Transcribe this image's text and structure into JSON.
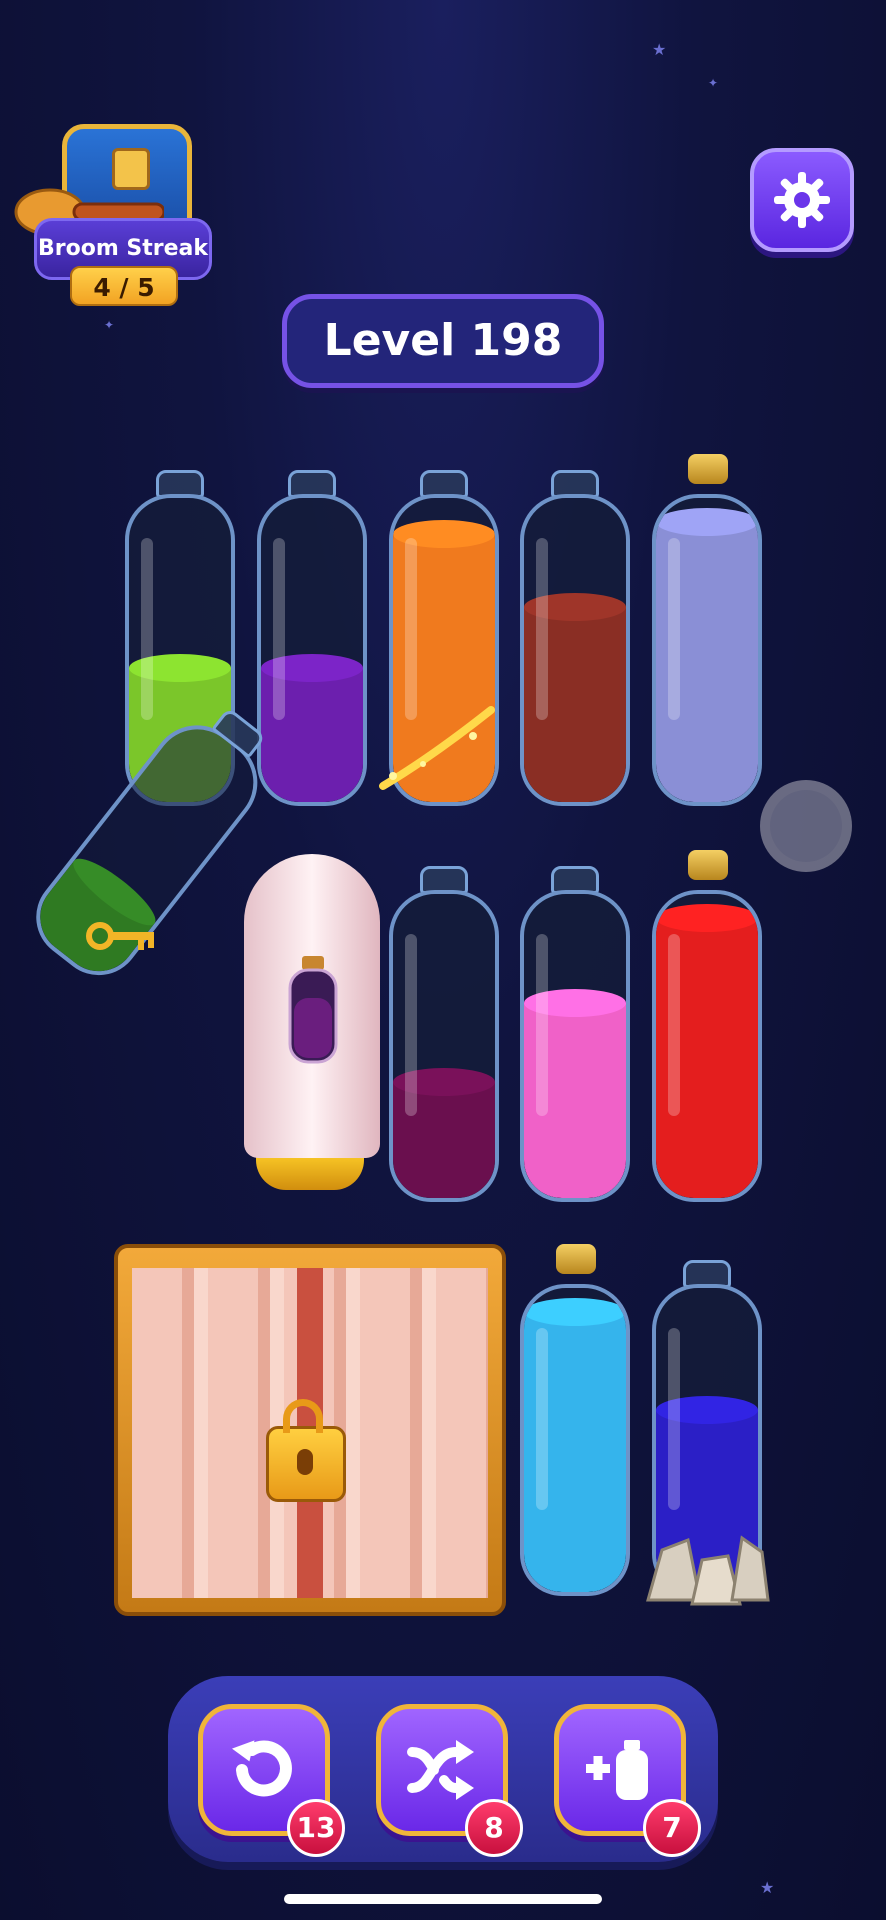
{
  "header": {
    "streak_label": "Broom Streak",
    "streak_count": "4 / 5",
    "level_label": "Level 198",
    "settings_icon": "gear-icon"
  },
  "bottles": [
    {
      "id": "b1",
      "color": "#7bc62a",
      "fill": 0.44,
      "corked": false
    },
    {
      "id": "b2",
      "color": "#6c1fae",
      "fill": 0.44,
      "corked": false
    },
    {
      "id": "b3",
      "color": "#f07a1e",
      "fill": 0.88,
      "corked": false
    },
    {
      "id": "b4",
      "color": "#8a2e24",
      "fill": 0.64,
      "corked": false
    },
    {
      "id": "b5",
      "color": "#8a8fd6",
      "fill": 0.92,
      "corked": true
    },
    {
      "id": "b6",
      "color": "#6a0f4e",
      "fill": 0.38,
      "corked": false
    },
    {
      "id": "b7",
      "color": "#f061c8",
      "fill": 0.64,
      "corked": false
    },
    {
      "id": "b8",
      "color": "#e41e1e",
      "fill": 0.92,
      "corked": true
    },
    {
      "id": "b9",
      "color": "#35b4ec",
      "fill": 0.92,
      "corked": true
    },
    {
      "id": "b10",
      "color": "#2b1fc6",
      "fill": 0.6,
      "corked": false
    }
  ],
  "tilted_bottle": {
    "color": "#2f7a22",
    "item": "key-icon"
  },
  "actions": [
    {
      "name": "undo-button",
      "icon": "undo-icon",
      "count": "13"
    },
    {
      "name": "shuffle-button",
      "icon": "shuffle-icon",
      "count": "8"
    },
    {
      "name": "add-bottle-button",
      "icon": "add-bottle-icon",
      "count": "7"
    }
  ]
}
